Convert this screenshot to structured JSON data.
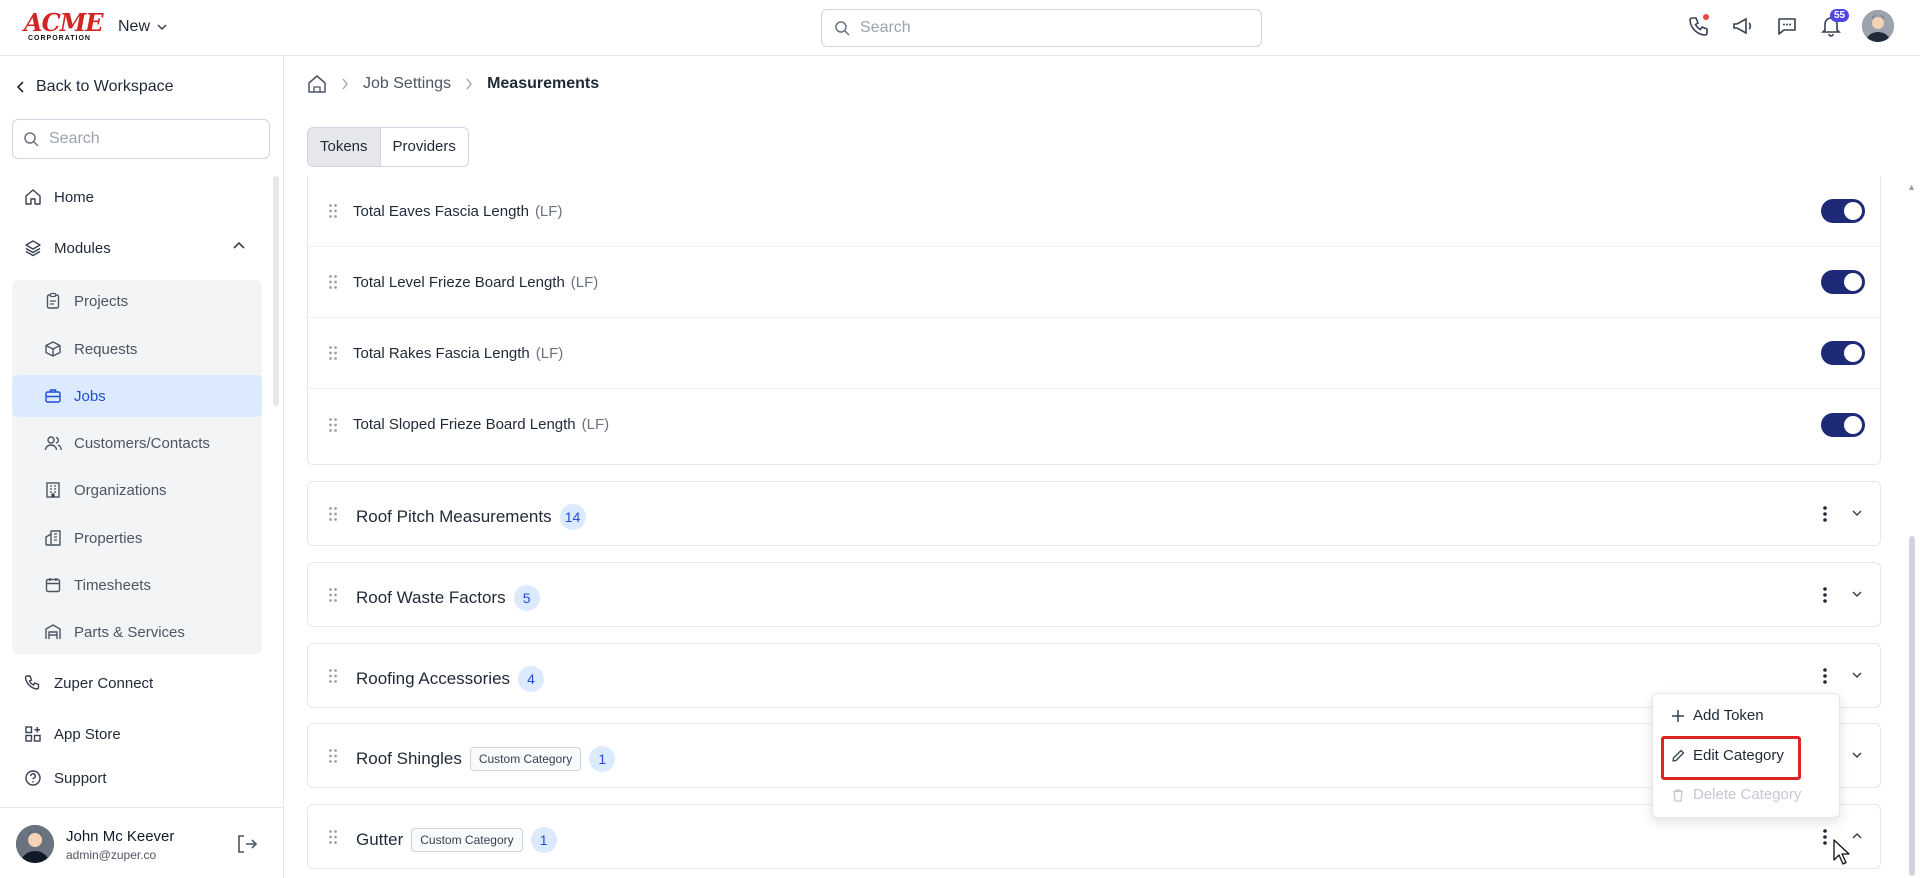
{
  "header": {
    "logo_line1": "ACME",
    "logo_line2": "CORPORATION",
    "new_label": "New",
    "search_placeholder": "Search",
    "notification_count": "55"
  },
  "sidebar": {
    "back_label": "Back to Workspace",
    "search_placeholder": "Search",
    "home": "Home",
    "modules": "Modules",
    "module_items": [
      "Projects",
      "Requests",
      "Jobs",
      "Customers/Contacts",
      "Organizations",
      "Properties",
      "Timesheets",
      "Parts & Services"
    ],
    "active_module": "Jobs",
    "zuper_connect": "Zuper Connect",
    "app_store": "App Store",
    "support": "Support",
    "user": {
      "name": "John Mc Keever",
      "email": "admin@zuper.co"
    }
  },
  "breadcrumb": {
    "section": "Job Settings",
    "current": "Measurements"
  },
  "tabs": [
    {
      "label": "Tokens",
      "active": true
    },
    {
      "label": "Providers",
      "active": false
    }
  ],
  "tokens": [
    {
      "name": "Total Eaves Fascia Length",
      "unit": "(LF)",
      "enabled": true
    },
    {
      "name": "Total Level Frieze Board Length",
      "unit": "(LF)",
      "enabled": true
    },
    {
      "name": "Total Rakes Fascia Length",
      "unit": "(LF)",
      "enabled": true
    },
    {
      "name": "Total Sloped Frieze Board Length",
      "unit": "(LF)",
      "enabled": true
    }
  ],
  "categories": [
    {
      "name": "Roof Pitch Measurements",
      "count": "14",
      "tag": ""
    },
    {
      "name": "Roof Waste Factors",
      "count": "5",
      "tag": ""
    },
    {
      "name": "Roofing Accessories",
      "count": "4",
      "tag": ""
    },
    {
      "name": "Roof Shingles",
      "count": "1",
      "tag": "Custom Category"
    },
    {
      "name": "Gutter",
      "count": "1",
      "tag": "Custom Category"
    }
  ],
  "context_menu": {
    "add_token": "Add Token",
    "edit_category": "Edit Category",
    "delete_category": "Delete Category"
  },
  "colors": {
    "accent": "#1d4ed8",
    "toggle": "#1e2a78",
    "highlight": "#dc2626",
    "brand": "#d32424"
  }
}
